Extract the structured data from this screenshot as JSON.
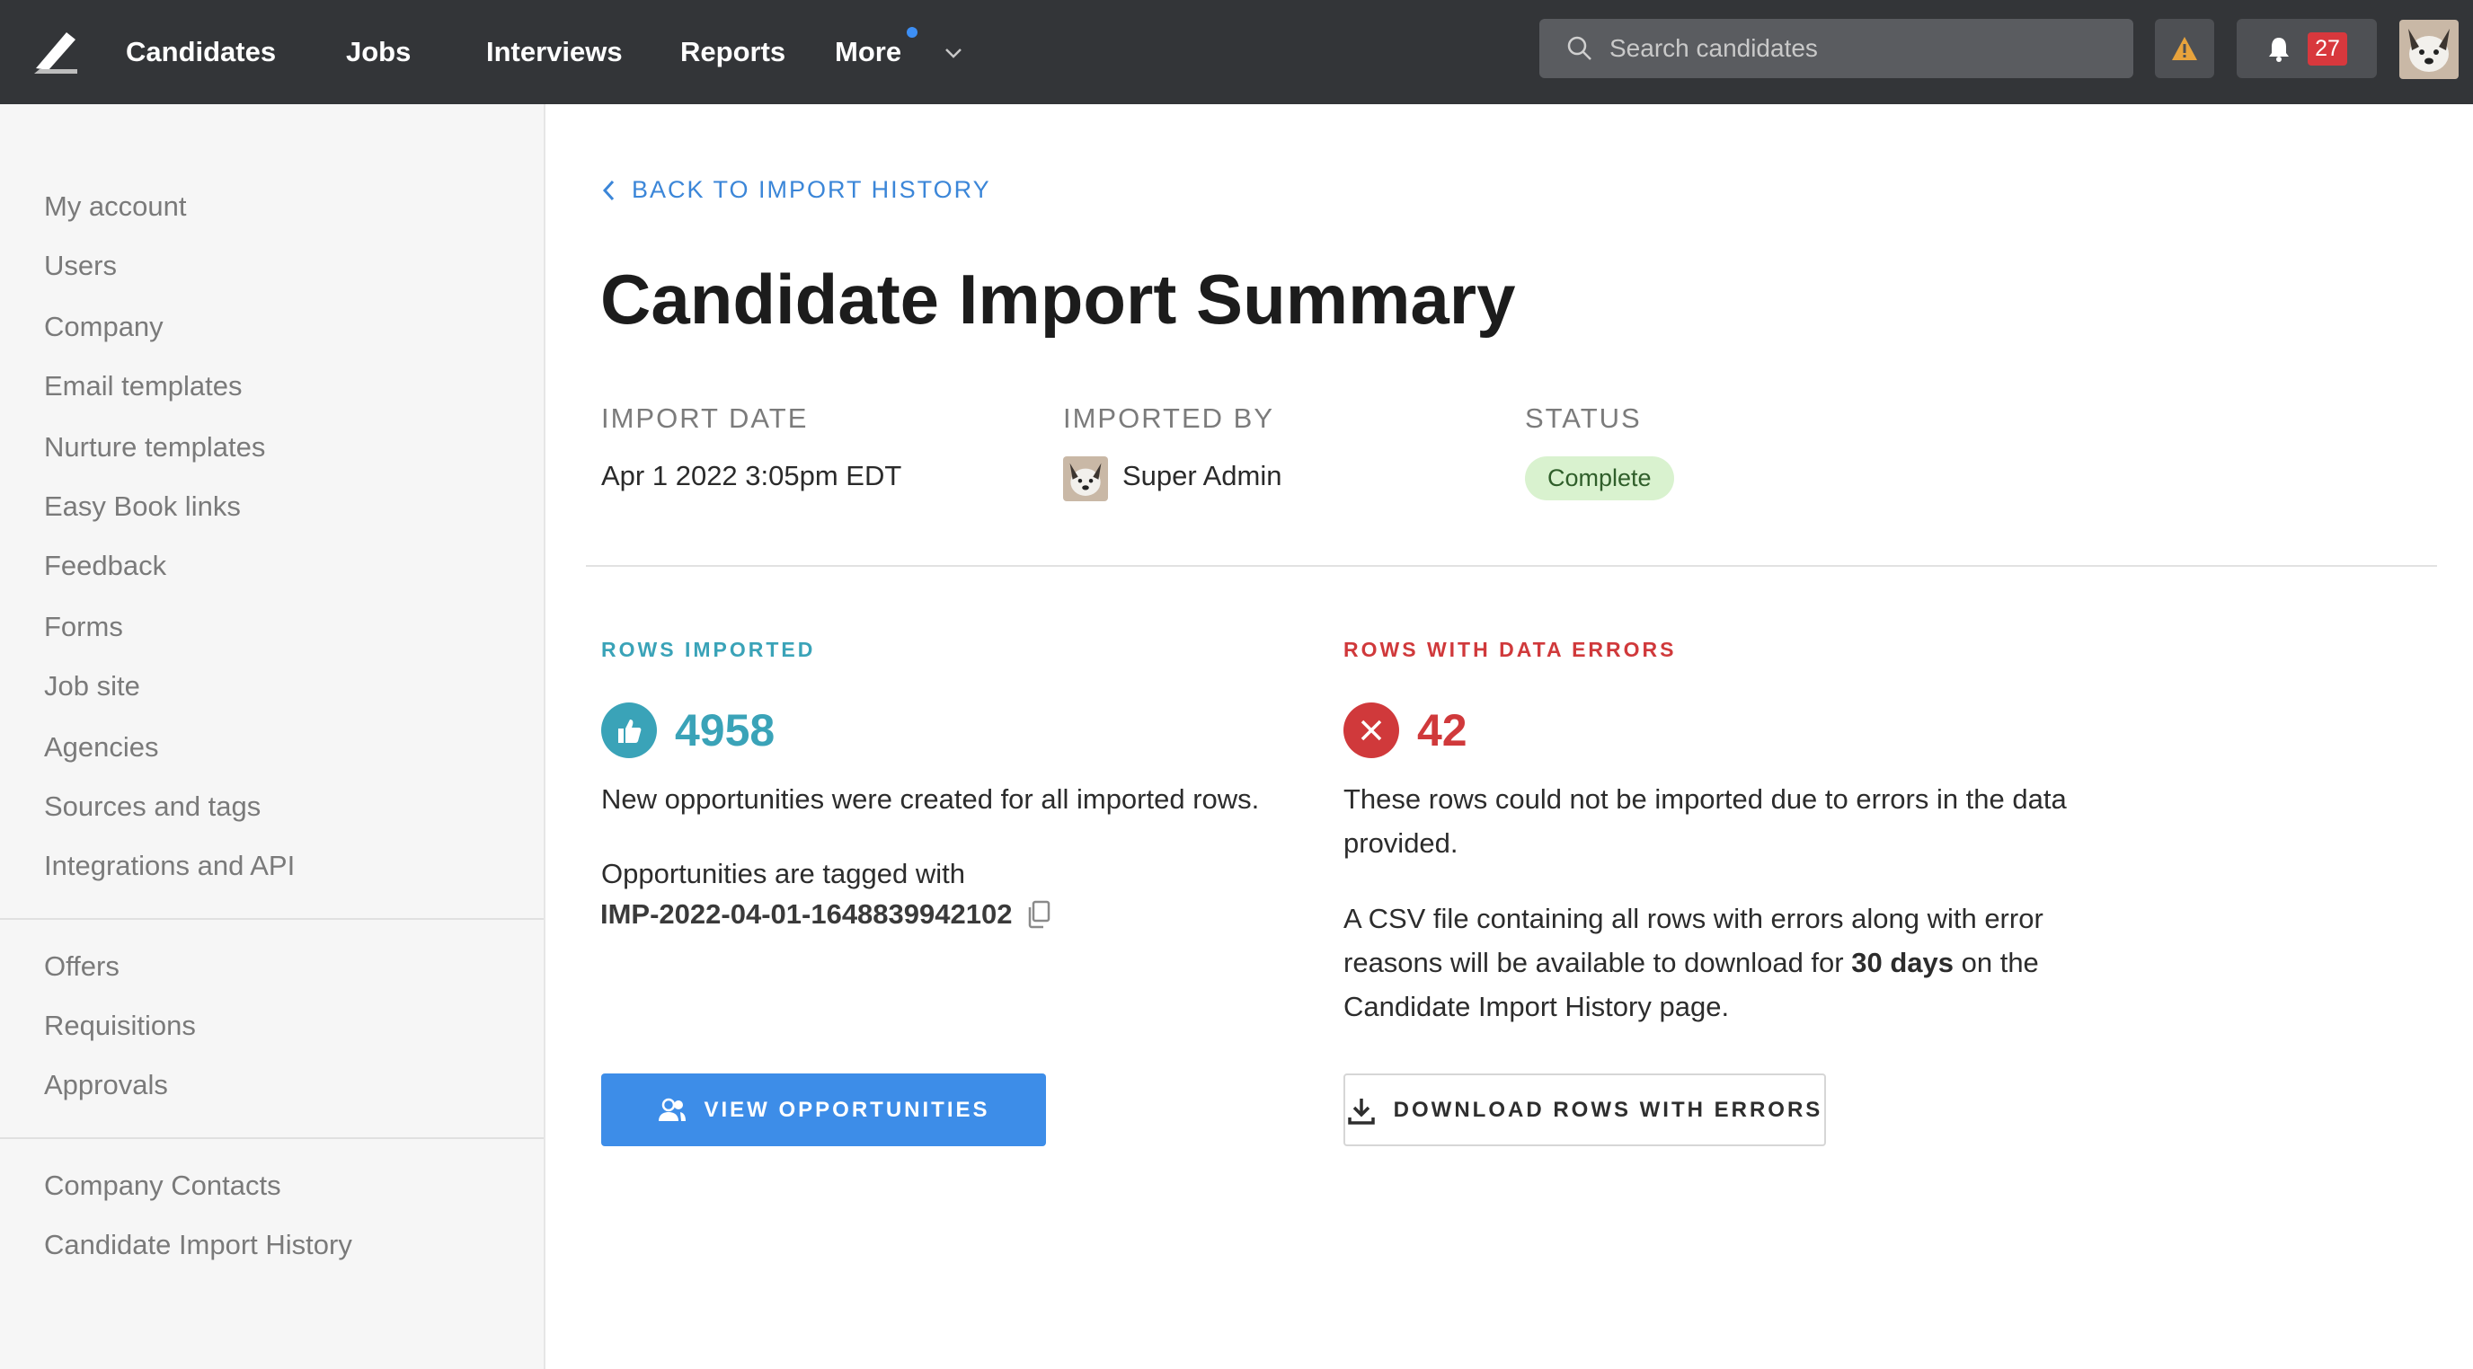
{
  "nav": {
    "items": [
      {
        "label": "Candidates"
      },
      {
        "label": "Jobs"
      },
      {
        "label": "Interviews"
      },
      {
        "label": "Reports"
      },
      {
        "label": "More"
      }
    ],
    "more_has_indicator": true,
    "search_placeholder": "Search candidates",
    "notification_count": "27",
    "accent_color": "#3d8ff5",
    "warning_color": "#e8a33c"
  },
  "sidebar": {
    "group1": [
      {
        "label": "My account"
      },
      {
        "label": "Users"
      },
      {
        "label": "Company"
      },
      {
        "label": "Email templates"
      },
      {
        "label": "Nurture templates"
      },
      {
        "label": "Easy Book links"
      },
      {
        "label": "Feedback"
      },
      {
        "label": "Forms"
      },
      {
        "label": "Job site"
      },
      {
        "label": "Agencies"
      },
      {
        "label": "Sources and tags"
      },
      {
        "label": "Integrations and API"
      }
    ],
    "group2": [
      {
        "label": "Offers"
      },
      {
        "label": "Requisitions"
      },
      {
        "label": "Approvals"
      }
    ],
    "group3": [
      {
        "label": "Company Contacts"
      },
      {
        "label": "Candidate Import History"
      }
    ]
  },
  "main": {
    "back_link": "BACK TO IMPORT HISTORY",
    "title": "Candidate Import Summary",
    "meta": {
      "import_date_label": "IMPORT DATE",
      "import_date": "Apr 1 2022 3:05pm EDT",
      "imported_by_label": "IMPORTED BY",
      "imported_by": "Super Admin",
      "status_label": "STATUS",
      "status": "Complete"
    },
    "imported": {
      "label": "ROWS IMPORTED",
      "count": "4958",
      "description": "New opportunities were created for all imported rows.",
      "tag_intro": "Opportunities are tagged with",
      "tag": "IMP-2022-04-01-1648839942102",
      "button": "VIEW OPPORTUNITIES",
      "color": "#3aa3b8"
    },
    "errors": {
      "label": "ROWS WITH DATA ERRORS",
      "count": "42",
      "description_line1": "These rows could not be imported due to errors in the data",
      "description_line2": "provided.",
      "csv_line1": "A CSV file containing all rows with errors along with error",
      "csv_line2_pre": "reasons will be available to download for ",
      "csv_line2_bold": "30 days",
      "csv_line2_post": " on the",
      "csv_line3": "Candidate Import History page.",
      "button": "DOWNLOAD ROWS WITH ERRORS",
      "color": "#d0393b"
    }
  }
}
